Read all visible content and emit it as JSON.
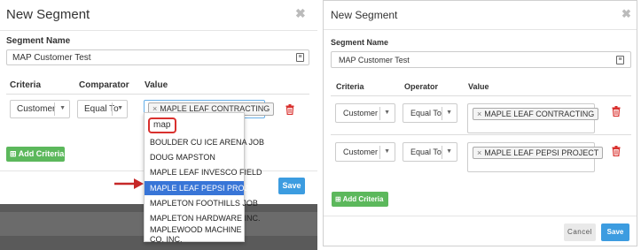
{
  "left": {
    "title": "New Segment",
    "close_glyph": "✖",
    "segment_label": "Segment Name",
    "segment_value": "MAP Customer Test",
    "headers": {
      "criteria": "Criteria",
      "comparator": "Comparator",
      "value": "Value"
    },
    "row": {
      "criteria": "Customer",
      "comparator": "Equal To",
      "selected_tag": "MAPLE LEAF CONTRACTING"
    },
    "dropdown": {
      "search": "map",
      "options": [
        {
          "label": "BOULDER CU ICE ARENA JOB",
          "highlighted": false
        },
        {
          "label": "DOUG MAPSTON",
          "highlighted": false
        },
        {
          "label": "MAPLE LEAF INVESCO FIELD",
          "highlighted": false
        },
        {
          "label": "MAPLE LEAF PEPSI PROJECT",
          "highlighted": true
        },
        {
          "label": "MAPLETON FOOTHILLS JOB",
          "highlighted": false
        },
        {
          "label": "MAPLETON HARDWARE INC.",
          "highlighted": false
        },
        {
          "label": "MAPLEWOOD MACHINE CO. INC.",
          "highlighted": false
        }
      ]
    },
    "add_criteria": "Add Criteria",
    "save": "Save"
  },
  "right": {
    "title": "New Segment",
    "close_glyph": "✖",
    "segment_label": "Segment Name",
    "segment_value": "MAP Customer Test",
    "headers": {
      "criteria": "Criteria",
      "operator": "Operator",
      "value": "Value"
    },
    "rows": [
      {
        "criteria": "Customer",
        "operator": "Equal To",
        "tag": "MAPLE LEAF CONTRACTING"
      },
      {
        "criteria": "Customer",
        "operator": "Equal To",
        "tag": "MAPLE LEAF PEPSI PROJECT"
      }
    ],
    "add_criteria": "Add Criteria",
    "cancel": "Cancel",
    "save": "Save"
  },
  "colors": {
    "accent_blue": "#3c9ce0",
    "success_green": "#5cb85c",
    "danger_red": "#d9312e",
    "highlight_blue": "#3875d7"
  },
  "icons": {
    "close": "close-icon",
    "calendar": "input-icon",
    "trash": "trash-icon",
    "plus": "plus-icon",
    "caret": "caret-down-icon",
    "remove_tag": "remove-tag-icon",
    "arrow": "red-arrow-icon"
  }
}
